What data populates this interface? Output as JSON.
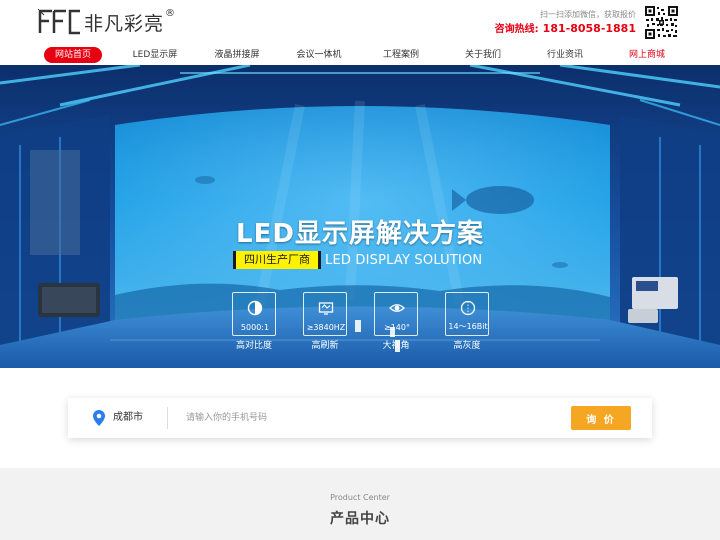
{
  "header": {
    "brand_name": "非凡彩亮",
    "brand_mark": "FFC",
    "registered_symbol": "®",
    "contact_tip": "扫一扫添加微信，获取报价",
    "hotline_label": "咨询热线:",
    "hotline_number": "181-8058-1881",
    "qr_icon": "qr-code-icon"
  },
  "nav": {
    "items": [
      {
        "label": "网站首页",
        "active": true
      },
      {
        "label": "LED显示屏",
        "active": false
      },
      {
        "label": "液晶拼接屏",
        "active": false
      },
      {
        "label": "会议一体机",
        "active": false
      },
      {
        "label": "工程案例",
        "active": false
      },
      {
        "label": "关于我们",
        "active": false
      },
      {
        "label": "行业资讯",
        "active": false
      },
      {
        "label": "网上商城",
        "active": false
      }
    ]
  },
  "banner": {
    "title": "LED显示屏解决方案",
    "badge": "四川生产厂商",
    "subtitle_en": "LED DISPLAY SOLUTION",
    "features": [
      {
        "value": "5000:1",
        "label": "高对比度",
        "icon": "contrast-icon"
      },
      {
        "value": "≥3840HZ",
        "label": "高刷新",
        "icon": "refresh-icon"
      },
      {
        "value": "≥140°",
        "label": "大视角",
        "icon": "eye-icon"
      },
      {
        "value": "14～16Bit",
        "label": "高灰度",
        "icon": "grayscale-icon"
      }
    ]
  },
  "inquiry": {
    "city": "成都市",
    "phone_placeholder": "请输入你的手机号码",
    "submit_label": "询 价"
  },
  "product_center": {
    "title_en": "Product Center",
    "title_cn": "产品中心"
  },
  "colors": {
    "brand_red": "#e60012",
    "badge_yellow": "#fff200",
    "button_orange": "#f5a623",
    "pin_blue": "#2b7de9"
  }
}
